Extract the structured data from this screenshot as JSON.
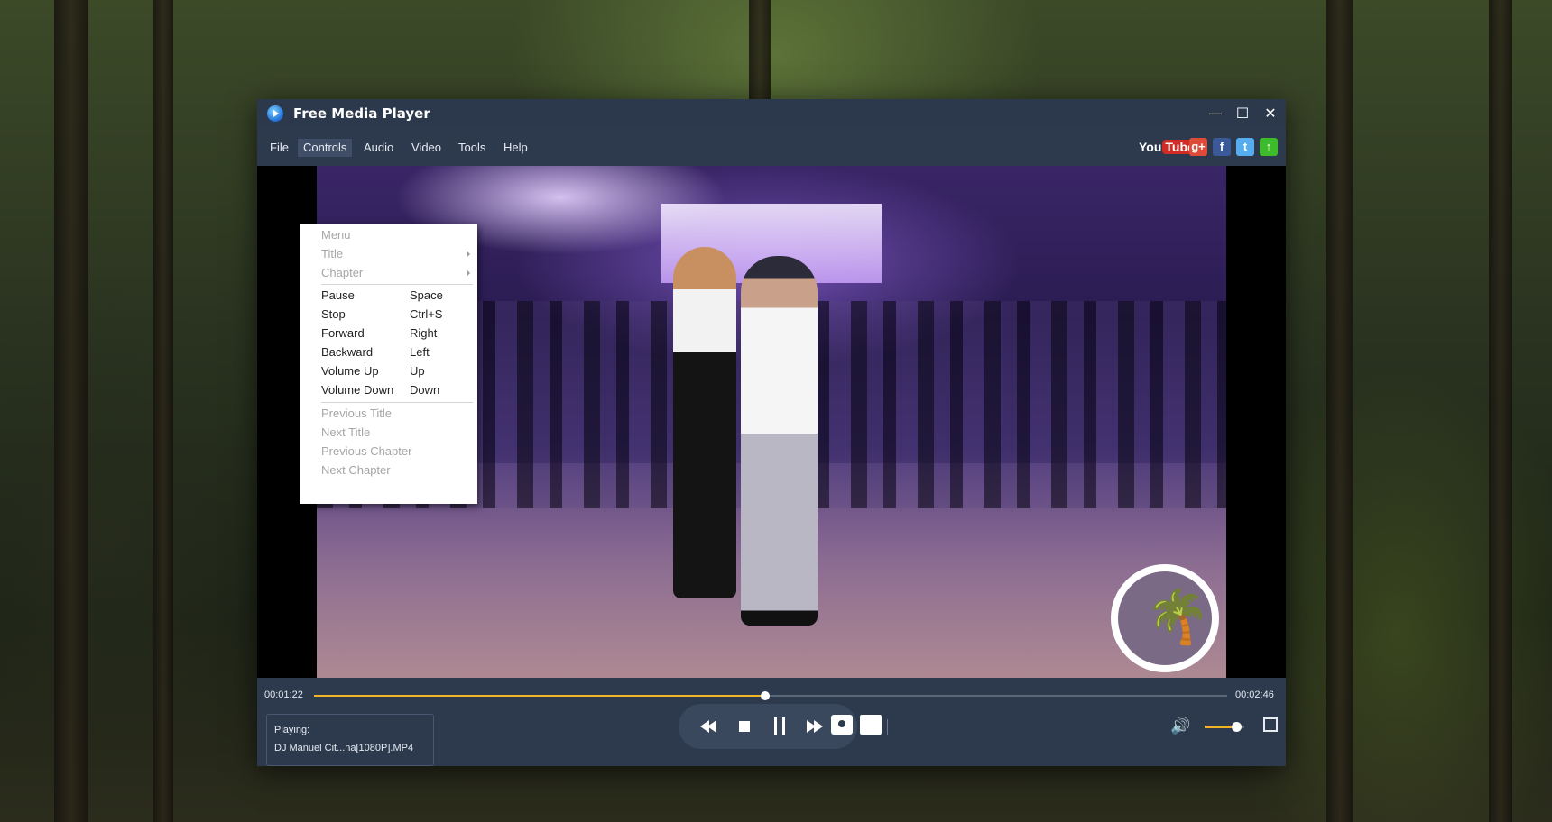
{
  "window": {
    "title": "Free Media Player",
    "controls": {
      "minimize": "—",
      "maximize": "☐",
      "close": "✕"
    }
  },
  "menubar": {
    "items": [
      {
        "label": "File"
      },
      {
        "label": "Controls",
        "active": true
      },
      {
        "label": "Audio"
      },
      {
        "label": "Video"
      },
      {
        "label": "Tools"
      },
      {
        "label": "Help"
      }
    ]
  },
  "social": {
    "youtube_you": "You",
    "youtube_tube": "Tube",
    "gplus": "g+",
    "facebook": "f",
    "twitter": "t",
    "upload": "↑",
    "colors": {
      "gplus": "#dd4b39",
      "facebook": "#3b5998",
      "twitter": "#55acee",
      "upload": "#3dbb2a"
    }
  },
  "controls_menu": {
    "items": [
      {
        "label": "Menu",
        "shortcut": "",
        "enabled": false,
        "submenu": false
      },
      {
        "label": "Title",
        "shortcut": "",
        "enabled": false,
        "submenu": true
      },
      {
        "label": "Chapter",
        "shortcut": "",
        "enabled": false,
        "submenu": true
      },
      {
        "label": "Pause",
        "shortcut": "Space",
        "enabled": true,
        "submenu": false
      },
      {
        "label": "Stop",
        "shortcut": "Ctrl+S",
        "enabled": true,
        "submenu": false
      },
      {
        "label": "Forward",
        "shortcut": "Right",
        "enabled": true,
        "submenu": false
      },
      {
        "label": "Backward",
        "shortcut": "Left",
        "enabled": true,
        "submenu": false
      },
      {
        "label": "Volume Up",
        "shortcut": "Up",
        "enabled": true,
        "submenu": false
      },
      {
        "label": "Volume Down",
        "shortcut": "Down",
        "enabled": true,
        "submenu": false
      },
      {
        "label": "Previous Title",
        "shortcut": "",
        "enabled": false,
        "submenu": false
      },
      {
        "label": "Next Title",
        "shortcut": "",
        "enabled": false,
        "submenu": false
      },
      {
        "label": "Previous Chapter",
        "shortcut": "",
        "enabled": false,
        "submenu": false
      },
      {
        "label": "Next Chapter",
        "shortcut": "",
        "enabled": false,
        "submenu": false
      }
    ]
  },
  "playback": {
    "elapsed": "00:01:22",
    "total": "00:02:46",
    "progress_fraction": 0.494,
    "volume_fraction": 0.8,
    "accent_color": "#f0b427"
  },
  "now_playing": {
    "label": "Playing:",
    "file": "DJ Manuel Cit...na[1080P].MP4"
  },
  "icons": [
    "rewind-icon",
    "stop-icon",
    "pause-icon",
    "fast-forward-icon",
    "camera-icon",
    "folder-icon",
    "volume-icon",
    "fullscreen-icon",
    "palm-tree-logo"
  ]
}
